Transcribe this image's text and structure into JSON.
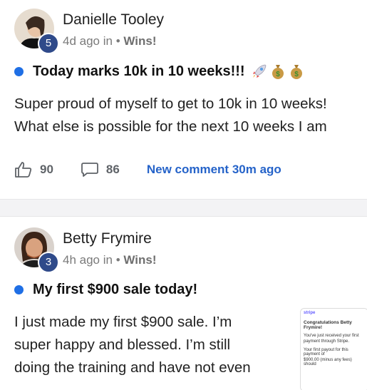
{
  "posts": [
    {
      "author": "Danielle Tooley",
      "level": "5",
      "time": "4d ago in",
      "category": "Wins!",
      "title": "Today marks 10k in 10 weeks!!!",
      "body": [
        "Super proud of myself to get to 10k in 10 weeks!",
        "What else is possible for the next 10 weeks I am"
      ],
      "likes": "90",
      "comments": "86",
      "new_comment": "New comment 30m ago",
      "emojis": [
        "rocket-icon",
        "money-bag-icon",
        "money-bag-icon"
      ]
    },
    {
      "author": "Betty Frymire",
      "level": "3",
      "time": "4h ago in",
      "category": "Wins!",
      "title": "My first $900 sale today!",
      "body": [
        "I just made my first $900 sale. I’m",
        "super happy and blessed. I’m still",
        "doing the training and have not even"
      ],
      "thumbnail": {
        "brand": "stripe",
        "heading": "Congratulations Betty Frymire!",
        "line1": "You've just received your first",
        "line2": "payment through Stripe.",
        "line3": "Your first payout for this payment of",
        "line4": "$900.00 (minus any fees) should"
      }
    }
  ],
  "colors": {
    "accent": "#1f6fe5",
    "link": "#2563c9",
    "badge": "#2f4a8a"
  }
}
